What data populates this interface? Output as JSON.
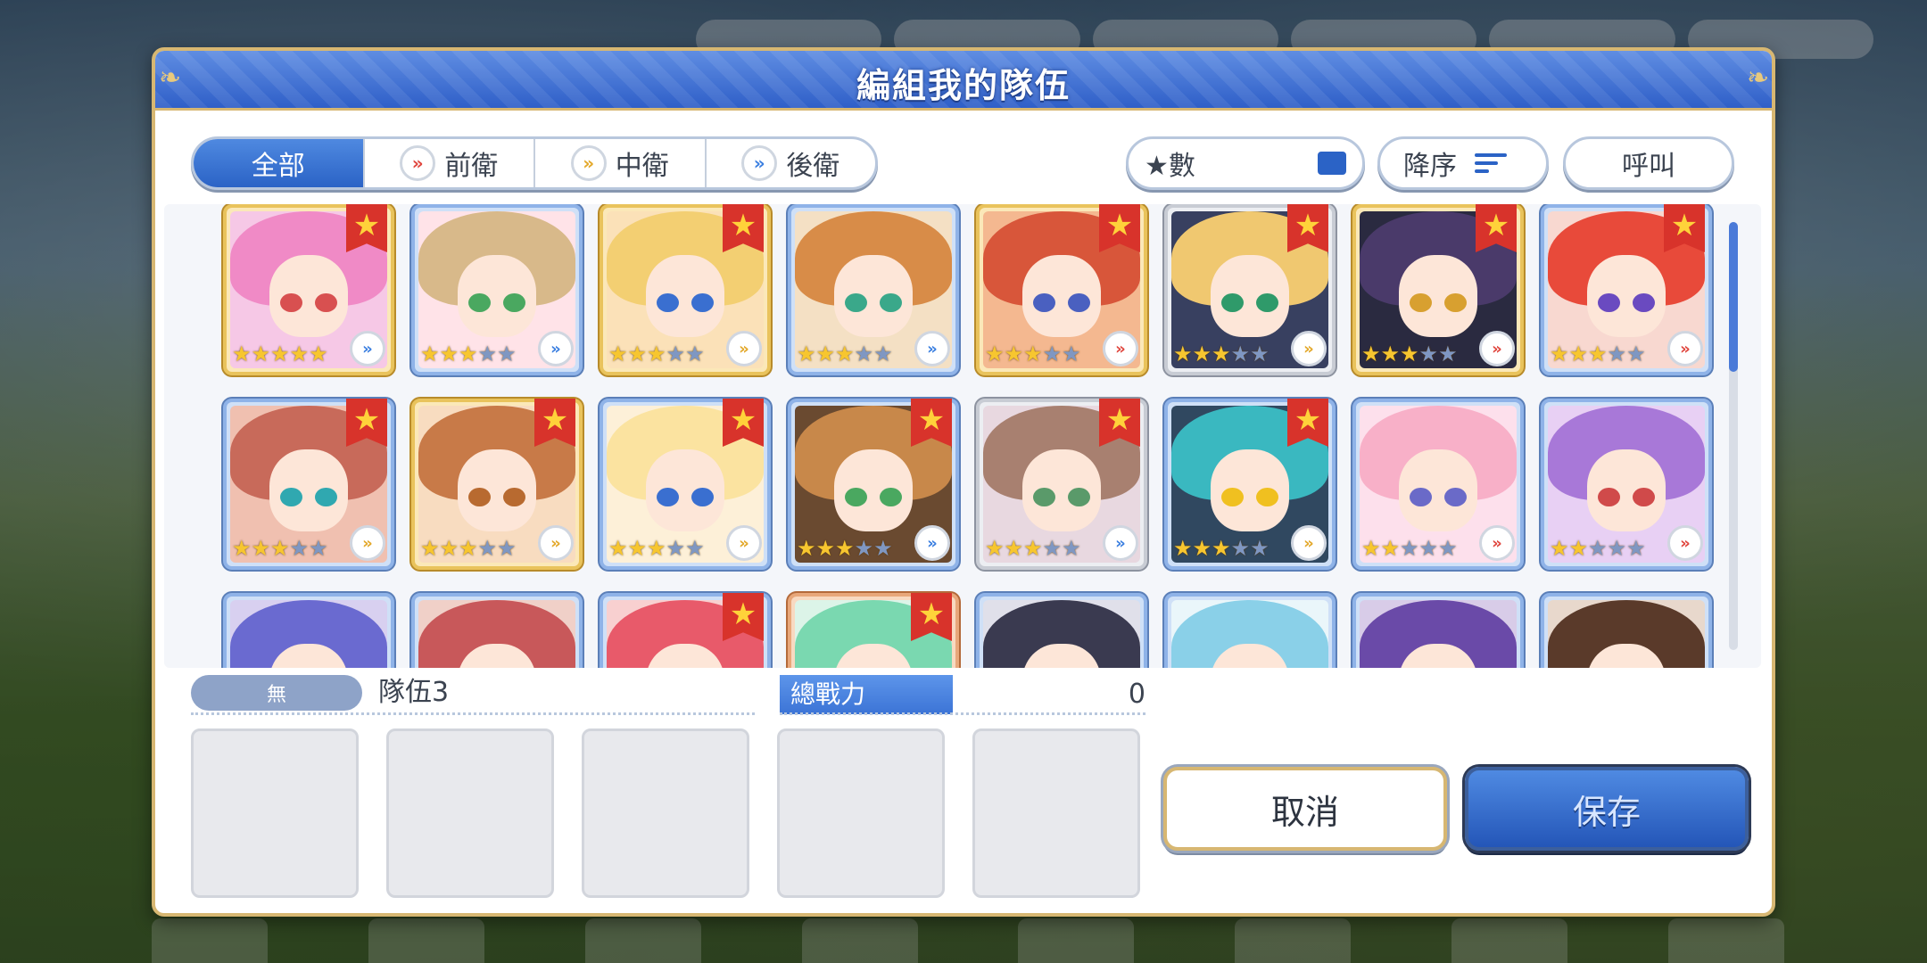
{
  "dialog": {
    "title": "編組我的隊伍"
  },
  "filters": {
    "tabs": [
      {
        "label": "全部",
        "role": ""
      },
      {
        "label": "前衛",
        "role": "front"
      },
      {
        "label": "中衛",
        "role": "middle"
      },
      {
        "label": "後衛",
        "role": "back"
      }
    ],
    "active_index": 0,
    "sort_label": "★數",
    "order_label": "降序",
    "call_label": "呼叫"
  },
  "roster": [
    {
      "stars": 5,
      "badge": true,
      "role": "back",
      "frame": "gold",
      "hair": "#f08ac6",
      "eyes": "#d85050",
      "bg": "#f6c8e6"
    },
    {
      "stars": 3,
      "badge": false,
      "role": "back",
      "frame": "blue",
      "hair": "#d8b98a",
      "eyes": "#4aa860",
      "bg": "#ffe3e8"
    },
    {
      "stars": 3,
      "badge": true,
      "role": "middle",
      "frame": "gold",
      "hair": "#f3cf72",
      "eyes": "#3a6fd0",
      "bg": "#fbe1b8"
    },
    {
      "stars": 3,
      "badge": false,
      "role": "back",
      "frame": "blue",
      "hair": "#d88c48",
      "eyes": "#3aa88a",
      "bg": "#f4e0c4"
    },
    {
      "stars": 3,
      "badge": true,
      "role": "front",
      "frame": "gold",
      "hair": "#d8563a",
      "eyes": "#4a60c0",
      "bg": "#f4b890"
    },
    {
      "stars": 3,
      "badge": true,
      "role": "middle",
      "frame": "silver",
      "hair": "#f0c870",
      "eyes": "#2f9a6a",
      "bg": "#384060"
    },
    {
      "stars": 3,
      "badge": true,
      "role": "front",
      "frame": "gold",
      "hair": "#4a3a6a",
      "eyes": "#d8a030",
      "bg": "#2a2a40"
    },
    {
      "stars": 3,
      "badge": true,
      "role": "front",
      "frame": "blue",
      "hair": "#e84a3a",
      "eyes": "#6a4ac0",
      "bg": "#f8d8d0"
    },
    {
      "stars": 3,
      "badge": true,
      "role": "middle",
      "frame": "blue",
      "hair": "#c86a5a",
      "eyes": "#30a8b0",
      "bg": "#f0c0b0"
    },
    {
      "stars": 3,
      "badge": true,
      "role": "middle",
      "frame": "gold",
      "hair": "#c87a48",
      "eyes": "#b86a30",
      "bg": "#f8dcc0"
    },
    {
      "stars": 3,
      "badge": true,
      "role": "middle",
      "frame": "blue",
      "hair": "#fbe3a0",
      "eyes": "#3a6fd0",
      "bg": "#fdf0d8"
    },
    {
      "stars": 3,
      "badge": true,
      "role": "back",
      "frame": "blue",
      "hair": "#c8884a",
      "eyes": "#4aa860",
      "bg": "#6a4a30"
    },
    {
      "stars": 3,
      "badge": true,
      "role": "back",
      "frame": "silver",
      "hair": "#a88070",
      "eyes": "#5a9a6a",
      "bg": "#e8d8e0"
    },
    {
      "stars": 3,
      "badge": true,
      "role": "middle",
      "frame": "blue",
      "hair": "#3ab8c0",
      "eyes": "#f0c020",
      "bg": "#304860"
    },
    {
      "stars": 2,
      "badge": false,
      "role": "front",
      "frame": "blue",
      "hair": "#f8b0c8",
      "eyes": "#6a6ac8",
      "bg": "#fde0ec"
    },
    {
      "stars": 2,
      "badge": false,
      "role": "front",
      "frame": "blue",
      "hair": "#a878d8",
      "eyes": "#d04a4a",
      "bg": "#e8d0f4"
    },
    {
      "stars": 0,
      "badge": false,
      "role": "",
      "frame": "blue",
      "hair": "#6a6ad0",
      "eyes": "#6a6ad0",
      "bg": "#d8d0f0"
    },
    {
      "stars": 0,
      "badge": false,
      "role": "",
      "frame": "blue",
      "hair": "#c8585a",
      "eyes": "#c8585a",
      "bg": "#f0d0c8"
    },
    {
      "stars": 0,
      "badge": true,
      "role": "",
      "frame": "blue",
      "hair": "#e85a6a",
      "eyes": "#e85a6a",
      "bg": "#f8d0d0"
    },
    {
      "stars": 0,
      "badge": true,
      "role": "",
      "frame": "copper",
      "hair": "#7ad8b0",
      "eyes": "#7ad8b0",
      "bg": "#dcf4e8"
    },
    {
      "stars": 0,
      "badge": false,
      "role": "",
      "frame": "blue",
      "hair": "#3a3a50",
      "eyes": "#3a3a50",
      "bg": "#e0e0ea"
    },
    {
      "stars": 0,
      "badge": false,
      "role": "",
      "frame": "blue",
      "hair": "#8ad0e8",
      "eyes": "#8ad0e8",
      "bg": "#eaf6fa"
    },
    {
      "stars": 0,
      "badge": false,
      "role": "",
      "frame": "blue",
      "hair": "#6a4aa8",
      "eyes": "#6a4aa8",
      "bg": "#d8cce8"
    },
    {
      "stars": 0,
      "badge": false,
      "role": "",
      "frame": "blue",
      "hair": "#5a3a2a",
      "eyes": "#5a3a2a",
      "bg": "#e8d8cc"
    }
  ],
  "party": {
    "type_label": "無",
    "team_name": "隊伍3",
    "power_label": "總戰力",
    "power_value": "0",
    "slots": 5
  },
  "buttons": {
    "cancel": "取消",
    "save": "保存"
  },
  "colors": {
    "accent": "#2b63c6",
    "frame_gold": "#e9c35c",
    "badge_red": "#d8332b",
    "star": "#f7c62f"
  }
}
